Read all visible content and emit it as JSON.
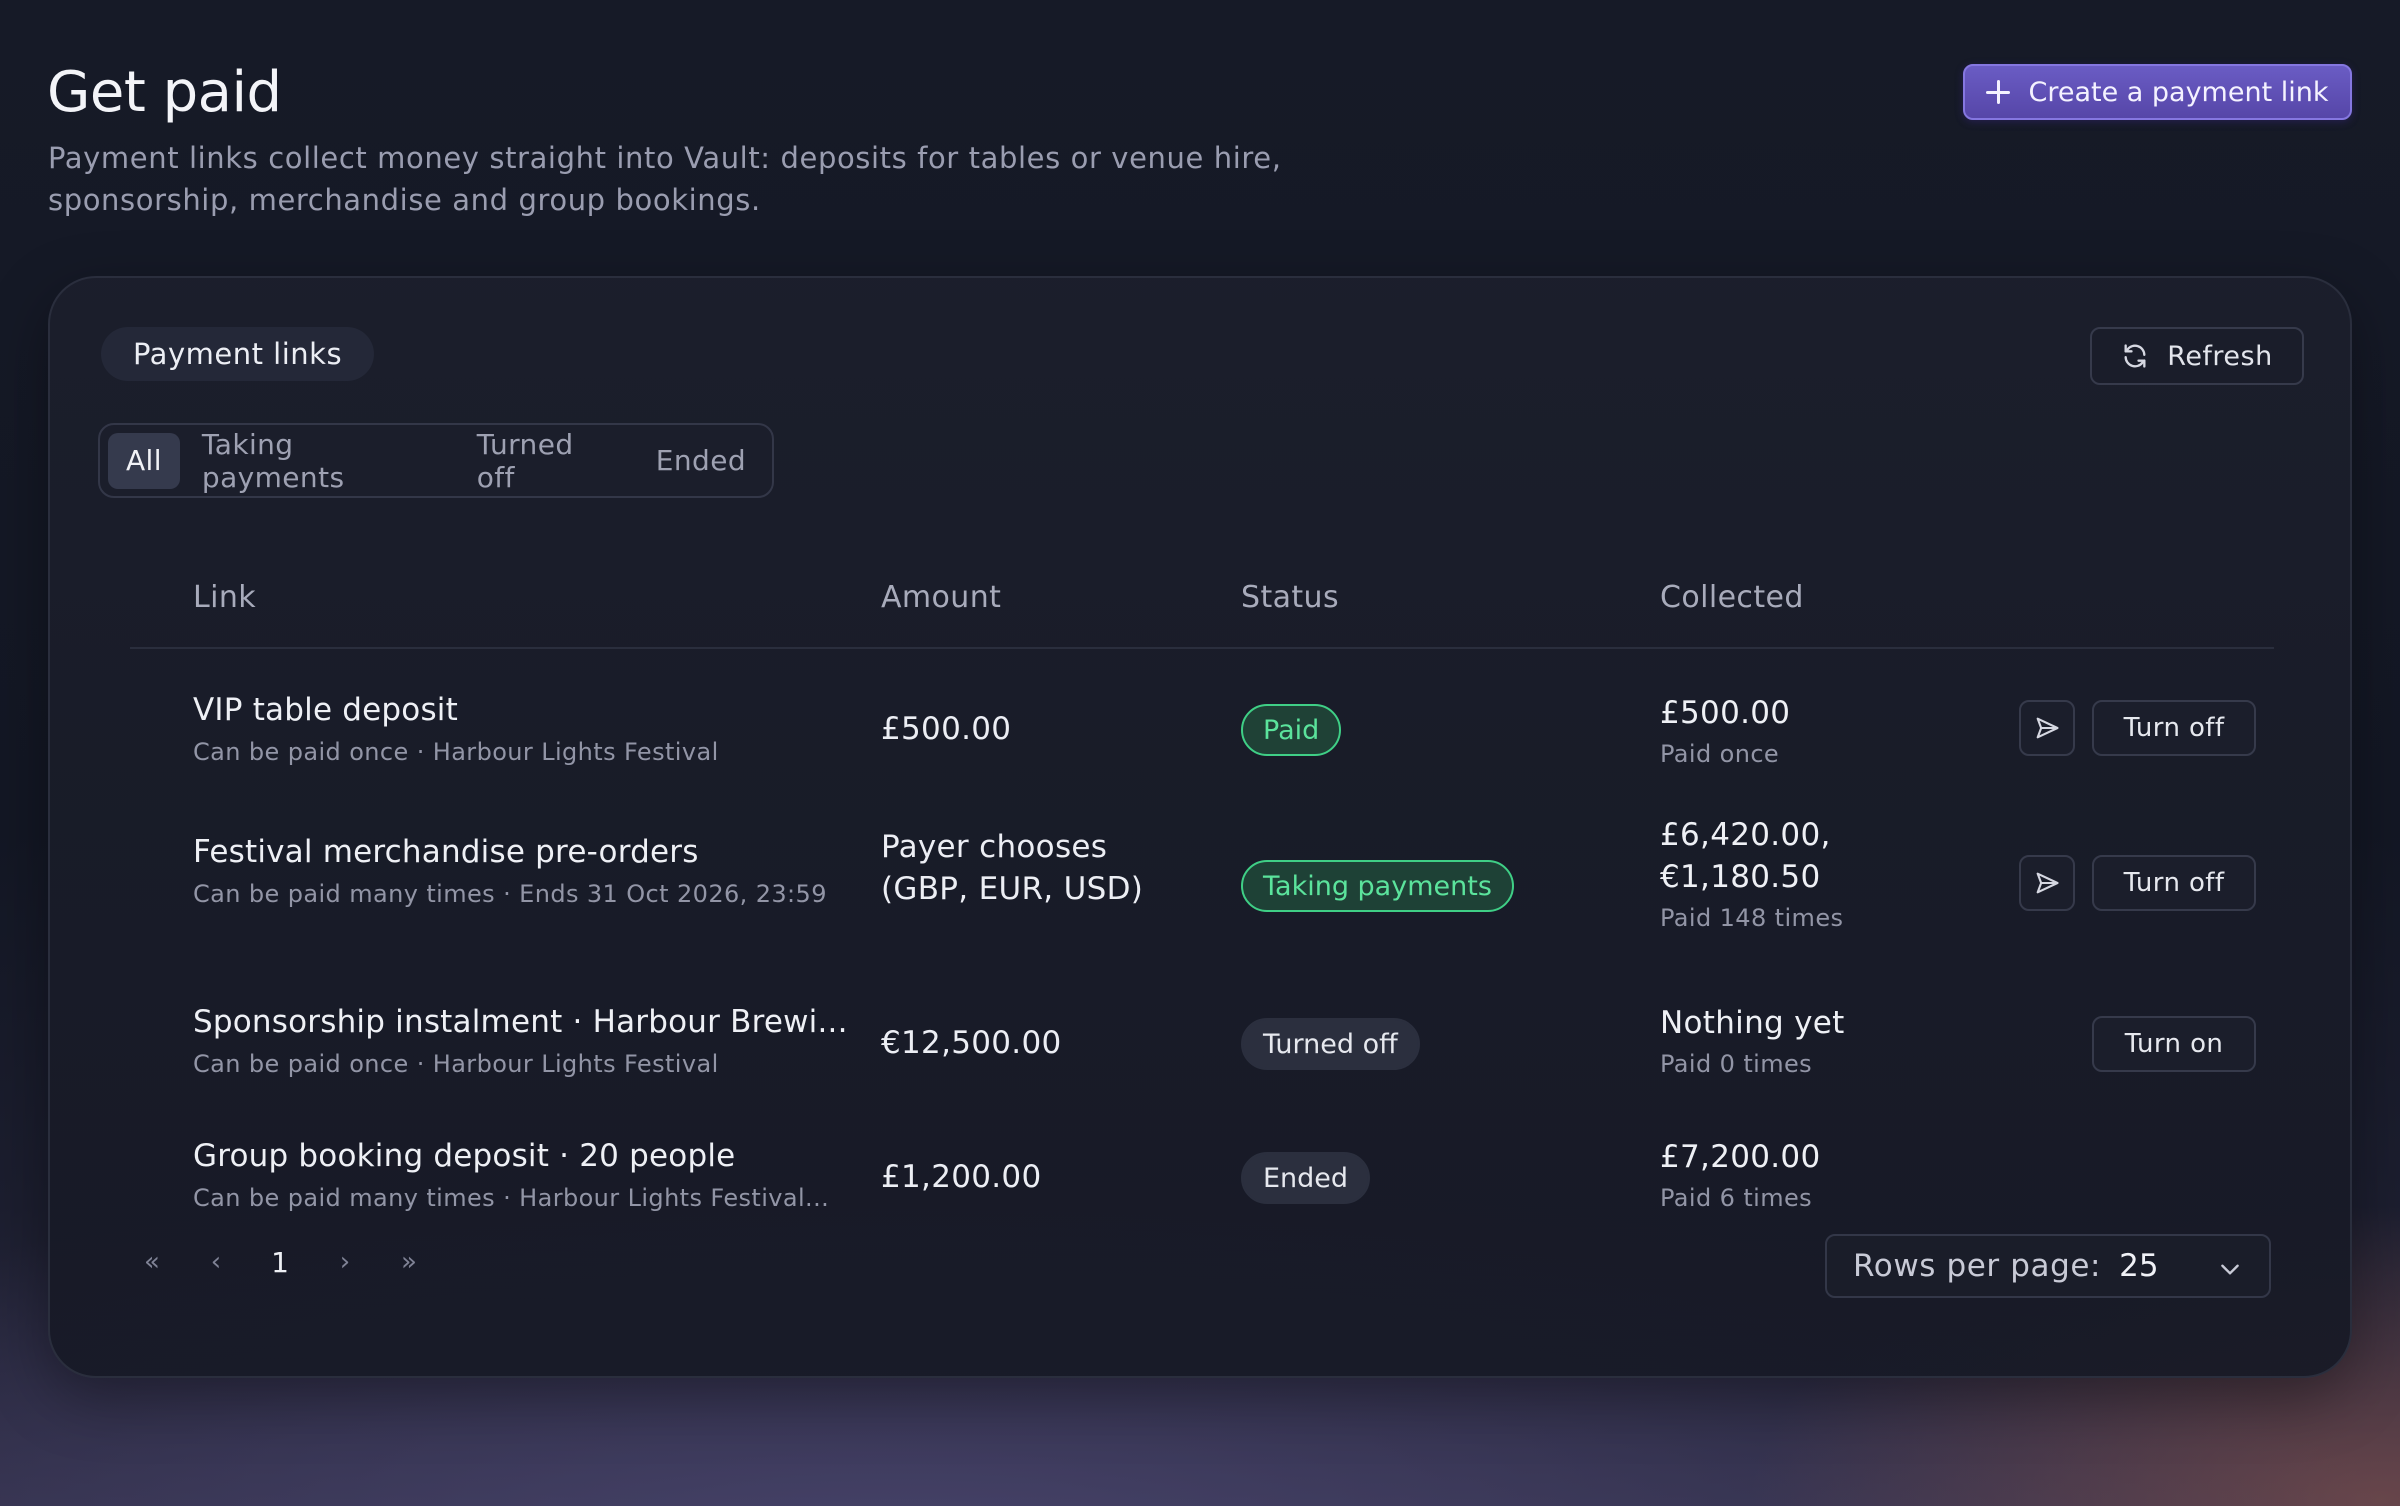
{
  "header": {
    "title": "Get paid",
    "subtitle": "Payment links collect money straight into Vault: deposits for tables or venue hire, sponsorship, merchandise and group bookings.",
    "create_label": "Create a payment link"
  },
  "card": {
    "title": "Payment links",
    "refresh_label": "Refresh"
  },
  "filters": [
    "All",
    "Taking payments",
    "Turned off",
    "Ended"
  ],
  "active_filter": "All",
  "table": {
    "columns": {
      "link": "Link",
      "amount": "Amount",
      "status": "Status",
      "collected": "Collected"
    },
    "rows": [
      {
        "title": "VIP table deposit",
        "subtitle": "Can be paid once · Harbour Lights Festival",
        "amount_line1": "£500.00",
        "amount_line2": "",
        "status": "Paid",
        "status_style": "green",
        "collected_line1": "£500.00",
        "collected_line2": "",
        "collected_count": "Paid once",
        "share": true,
        "action": "Turn off"
      },
      {
        "title": "Festival merchandise pre-orders",
        "subtitle": "Can be paid many times · Ends 31 Oct 2026, 23:59",
        "amount_line1": "Payer chooses",
        "amount_line2": "(GBP, EUR, USD)",
        "status": "Taking payments",
        "status_style": "green",
        "collected_line1": "£6,420.00,",
        "collected_line2": "€1,180.50",
        "collected_count": "Paid 148 times",
        "share": true,
        "action": "Turn off"
      },
      {
        "title": "Sponsorship instalment · Harbour Brewi...",
        "subtitle": "Can be paid once · Harbour Lights Festival",
        "amount_line1": "€12,500.00",
        "amount_line2": "",
        "status": "Turned off",
        "status_style": "gray",
        "collected_line1": "Nothing yet",
        "collected_line2": "",
        "collected_count": "Paid 0 times",
        "share": false,
        "action": "Turn on"
      },
      {
        "title": "Group booking deposit · 20 people",
        "subtitle": "Can be paid many times · Harbour Lights Festival...",
        "amount_line1": "£1,200.00",
        "amount_line2": "",
        "status": "Ended",
        "status_style": "gray",
        "collected_line1": "£7,200.00",
        "collected_line2": "",
        "collected_count": "Paid 6 times",
        "share": false,
        "action": ""
      }
    ]
  },
  "pagination": {
    "first": "«",
    "prev": "‹",
    "page": "1",
    "next": "›",
    "last": "»",
    "rows_label": "Rows per page:",
    "rows_value": "25"
  },
  "icons": {
    "create": "plus-icon",
    "refresh": "refresh-icon",
    "share": "send-icon",
    "select": "chevron-down-icon"
  },
  "colors": {
    "accent": "#5a4bb0",
    "success": "#3fcf86",
    "background": "#141826"
  }
}
